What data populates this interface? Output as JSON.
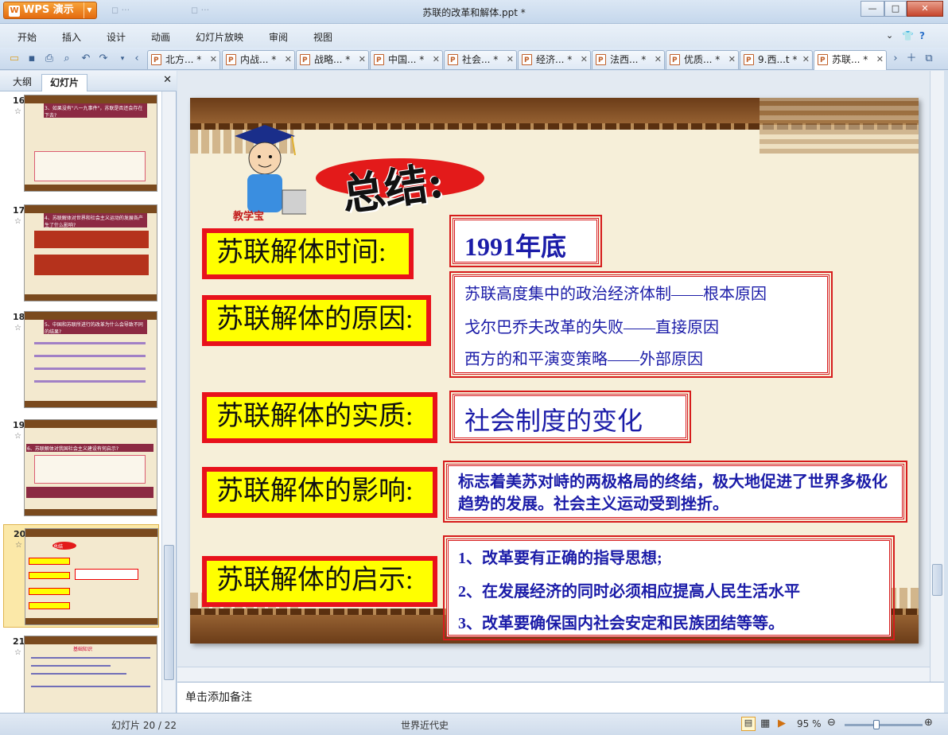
{
  "window": {
    "app_button": "WPS 演示",
    "title": "苏联的改革和解体.ppt *",
    "min": "—",
    "max": "□",
    "close": "✕"
  },
  "menu": [
    "开始",
    "插入",
    "设计",
    "动画",
    "幻灯片放映",
    "审阅",
    "视图"
  ],
  "doc_tabs": [
    "北方... *",
    "内战... *",
    "战略... *",
    "中国... *",
    "社会... *",
    "经济... *",
    "法西... *",
    "优质... *",
    "9.西...t *",
    "苏联... *"
  ],
  "left_panel": {
    "tab_outline": "大纲",
    "tab_slides": "幻灯片",
    "close": "✕"
  },
  "thumbs": [
    {
      "num": "16",
      "text": "3、如果没有\"八一九事件\"，苏联是否还会存在下去?"
    },
    {
      "num": "17",
      "text": "4、苏联解体对世界和社会主义运动的发展各产生了什么影响?"
    },
    {
      "num": "18",
      "text": "5、中国和苏联所进行的改革为什么会导致不同的结果?"
    },
    {
      "num": "19",
      "text": "6、苏联解体对我国社会主义建设有何启示?"
    },
    {
      "num": "20",
      "text": "总结"
    },
    {
      "num": "21",
      "text": "基础知识"
    }
  ],
  "slide": {
    "mascot_label": "教学宝",
    "heading": "总结:",
    "labels": [
      "苏联解体时间:",
      "苏联解体的原因:",
      "苏联解体的实质:",
      "苏联解体的影响:",
      "苏联解体的启示:"
    ],
    "time": "1991年底",
    "causes": [
      "苏联高度集中的政治经济体制——根本原因",
      "戈尔巴乔夫改革的失败——直接原因",
      "西方的和平演变策略——外部原因"
    ],
    "essence": "社会制度的变化",
    "impact": "标志着美苏对峙的两极格局的终结，极大地促进了世界多极化趋势的发展。社会主义运动受到挫折。",
    "lessons": [
      "1、改革要有正确的指导思想;",
      "2、在发展经济的同时必须相应提高人民生活水平",
      "3、改革要确保国内社会安定和民族团结等等。"
    ]
  },
  "notes_placeholder": "单击添加备注",
  "status": {
    "slide_count": "幻灯片 20 / 22",
    "theme": "世界近代史",
    "zoom": "95 %"
  },
  "colors": {
    "label_bg": "#ffff00",
    "label_border": "#e8121c",
    "box_text": "#1b1ca8",
    "frame": "#7a4a1e"
  }
}
